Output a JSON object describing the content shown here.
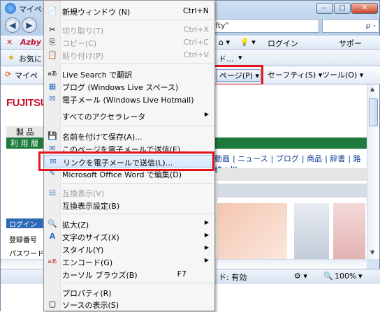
{
  "window": {
    "title": "マイペー",
    "address_text": "fty\"",
    "search_text": "ρ -",
    "win_buttons": [
      "–",
      "□",
      "✕"
    ]
  },
  "linkbar": {
    "left_text": "Azby",
    "items": [
      "ログイン",
      "サポー"
    ]
  },
  "favbar": {
    "fav_label": "お気に",
    "right_text": "ド..."
  },
  "tabbar": {
    "tab_label": "マイペ"
  },
  "cmdbar": {
    "page_label": "ページ(P)",
    "safety_label": "セーフティ(S)",
    "tools_label": "ツール(O)"
  },
  "page": {
    "brand": "FUJITSU",
    "products_label": "製 品",
    "users_label": "利 用 層",
    "site_tabs": [
      "動画",
      "ニュース",
      "ブログ",
      "商品",
      "辞書",
      "路線",
      "地"
    ],
    "login_head": "ログイン",
    "login_fields": [
      "登録番号",
      "パスワード"
    ]
  },
  "statusbar": {
    "mode": "ド: 有効",
    "zoom": "100%"
  },
  "menu": {
    "items": [
      {
        "icon": "📄",
        "label": "新規ウィンドウ (N)",
        "shortcut": "Ctrl+N",
        "disabled": false
      },
      {
        "icon": "✂",
        "label": "切り取り(T)",
        "shortcut": "Ctrl+X",
        "disabled": true
      },
      {
        "icon": "⎘",
        "label": "コピー(C)",
        "shortcut": "Ctrl+C",
        "disabled": true
      },
      {
        "icon": "📋",
        "label": "貼り付け(P)",
        "shortcut": "Ctrl+V",
        "disabled": true
      },
      {
        "icon": "aあ",
        "label": "Live Search で翻訳",
        "shortcut": "",
        "disabled": false
      },
      {
        "icon": "▦",
        "label": "ブログ (Windows Live スペース)",
        "shortcut": "",
        "disabled": false
      },
      {
        "icon": "✉",
        "label": "電子メール (Windows Live Hotmail)",
        "shortcut": "",
        "disabled": false
      },
      {
        "icon": "",
        "label": "すべてのアクセラレータ",
        "shortcut": "▶",
        "disabled": false
      },
      {
        "icon": "💾",
        "label": "名前を付けて保存(A)...",
        "shortcut": "",
        "disabled": false
      },
      {
        "icon": "✉",
        "label": "このページを電子メールで送信(E)...",
        "shortcut": "",
        "disabled": false
      },
      {
        "icon": "✉",
        "label": "リンクを電子メールで送信(L)...",
        "shortcut": "",
        "disabled": false
      },
      {
        "icon": "✎",
        "label": "Microsoft Office Word で編集(D)",
        "shortcut": "",
        "disabled": false
      },
      {
        "icon": "▤",
        "label": "互換表示(V)",
        "shortcut": "",
        "disabled": true
      },
      {
        "icon": "",
        "label": "互換表示設定(B)",
        "shortcut": "",
        "disabled": false
      },
      {
        "icon": "🔍",
        "label": "拡大(Z)",
        "shortcut": "▶",
        "disabled": false
      },
      {
        "icon": "A",
        "label": "文字のサイズ(X)",
        "shortcut": "▶",
        "disabled": false
      },
      {
        "icon": "",
        "label": "スタイル(Y)",
        "shortcut": "▶",
        "disabled": false
      },
      {
        "icon": "aあ",
        "label": "エンコード(G)",
        "shortcut": "▶",
        "disabled": false
      },
      {
        "icon": "",
        "label": "カーソル ブラウズ(B)",
        "shortcut": "F7",
        "disabled": false
      },
      {
        "icon": "",
        "label": "プロパティ(R)",
        "shortcut": "",
        "disabled": false
      },
      {
        "icon": "▢",
        "label": "ソースの表示(S)",
        "shortcut": "",
        "disabled": false
      }
    ]
  }
}
